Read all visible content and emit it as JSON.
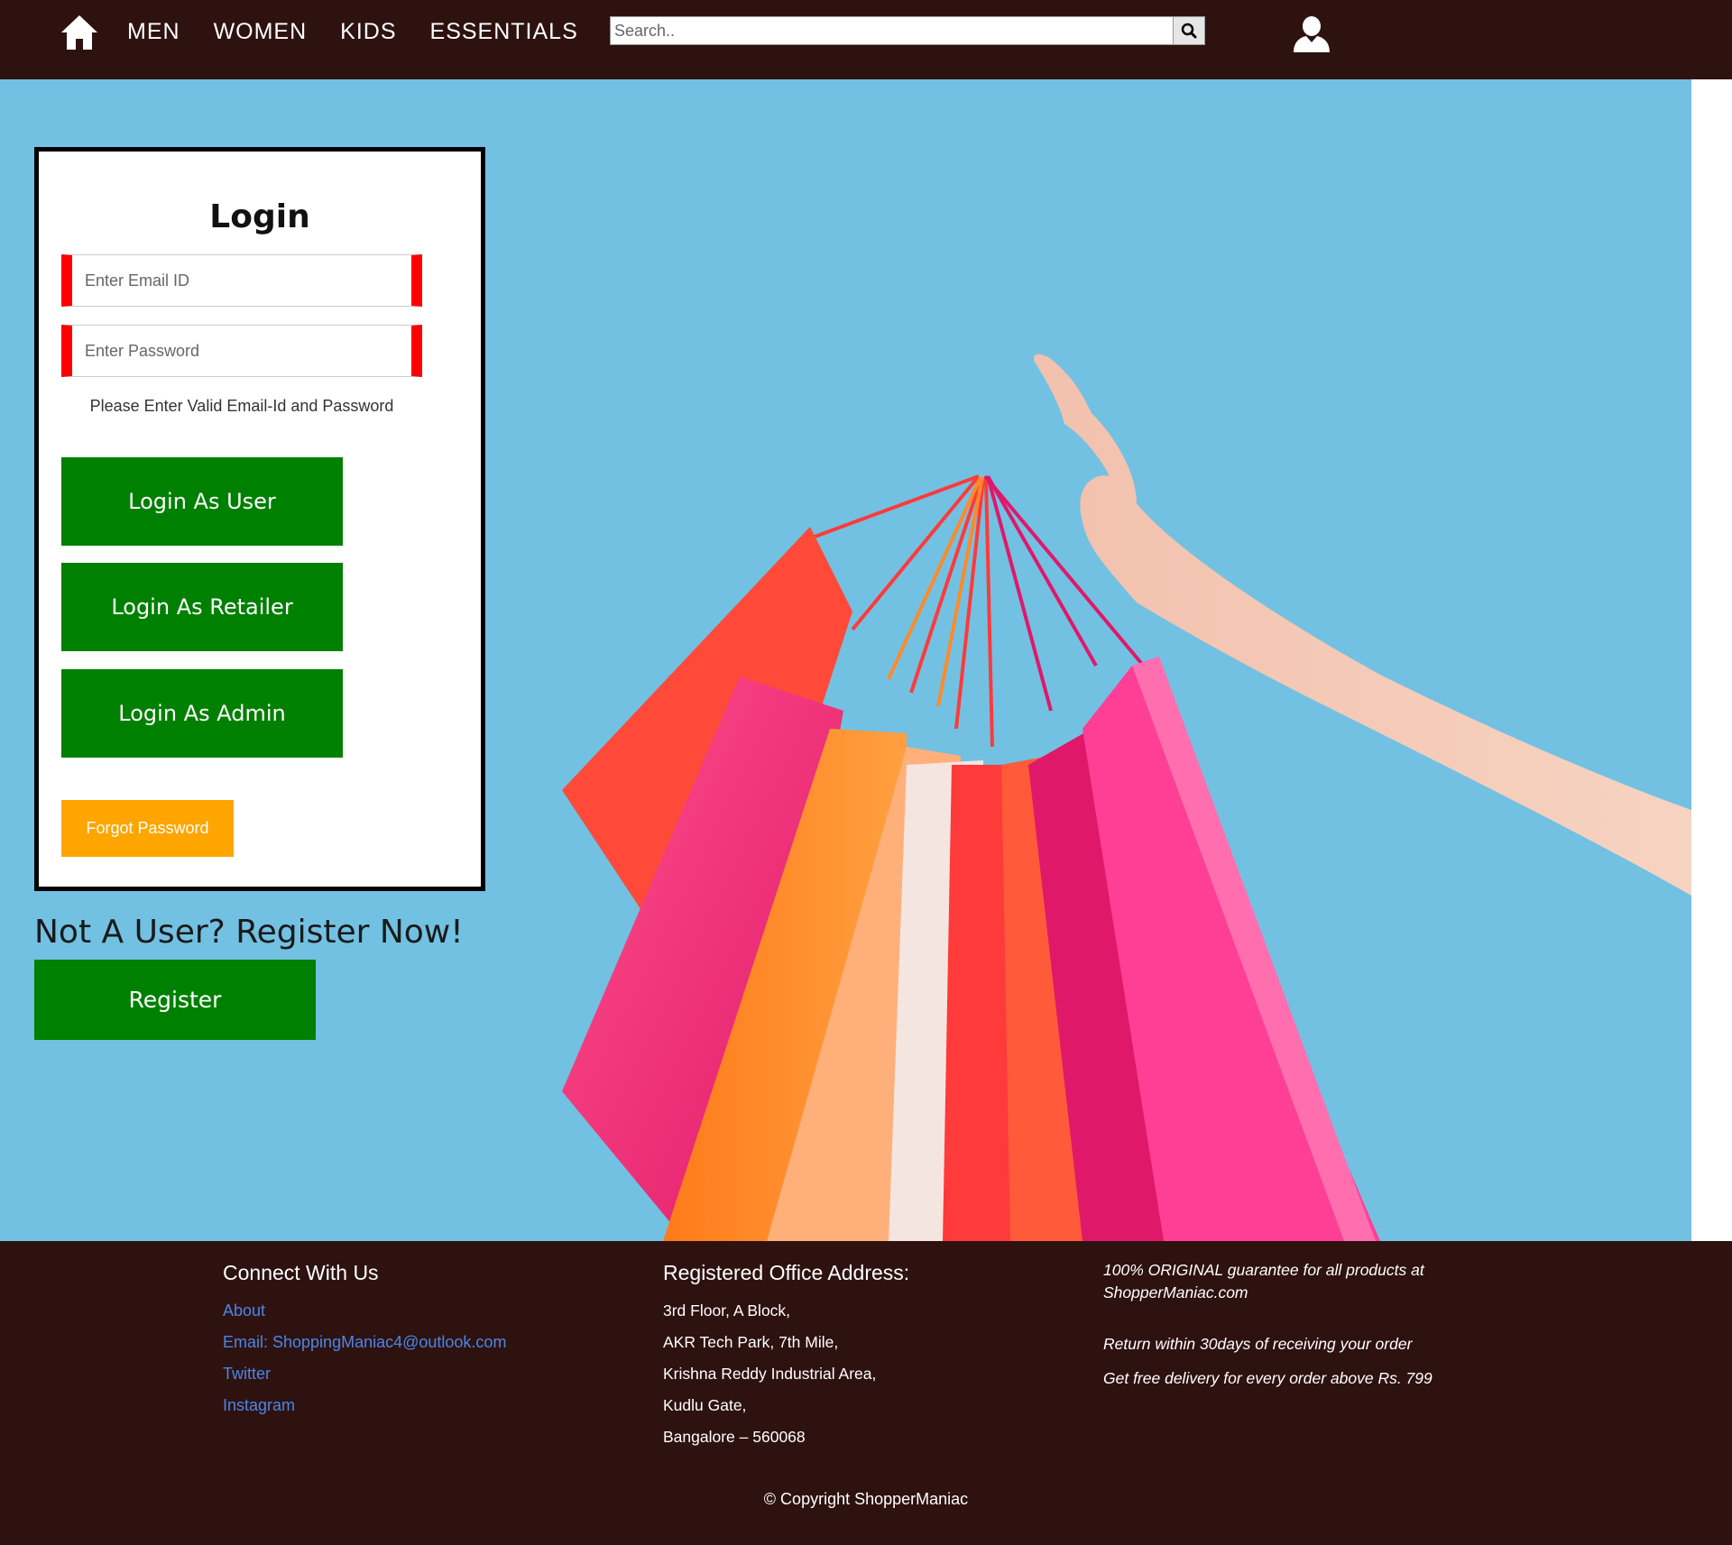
{
  "colors": {
    "navbar_bg": "#2e1210",
    "hero_bg": "#72c1e2",
    "button_green": "#008000",
    "button_orange": "#ffa500",
    "field_accent": "#ff0000",
    "footer_link": "#4a86e8"
  },
  "nav": {
    "home_icon": "home-icon",
    "links": [
      "MEN",
      "WOMEN",
      "KIDS",
      "ESSENTIALS"
    ],
    "search_placeholder": "Search..",
    "search_icon": "search-icon",
    "user_icon": "user-icon"
  },
  "login": {
    "title": "Login",
    "email_placeholder": "Enter Email ID",
    "password_placeholder": "Enter Password",
    "error": "Please Enter Valid Email-Id and Password",
    "btn_user": "Login As User",
    "btn_retailer": "Login As Retailer",
    "btn_admin": "Login As Admin",
    "btn_forgot": "Forgot Password"
  },
  "register": {
    "heading": "Not A User? Register Now!",
    "button": "Register"
  },
  "footer": {
    "connect": {
      "heading": "Connect With Us",
      "links": [
        "About",
        "Email: ShoppingManiac4@outlook.com",
        "Twitter",
        "Instagram"
      ]
    },
    "address": {
      "heading": "Registered Office Address:",
      "lines": [
        "3rd Floor, A Block,",
        "AKR Tech Park, 7th Mile,",
        "Krishna Reddy Industrial Area,",
        "Kudlu Gate,",
        "Bangalore – 560068"
      ]
    },
    "promises": {
      "guarantee": "100% ORIGINAL guarantee for all products at ShopperManiac.com",
      "returns": "Return within 30days of receiving your order",
      "delivery": "Get free delivery for every order above Rs. 799"
    },
    "copyright": "© Copyright ShopperManiac"
  }
}
